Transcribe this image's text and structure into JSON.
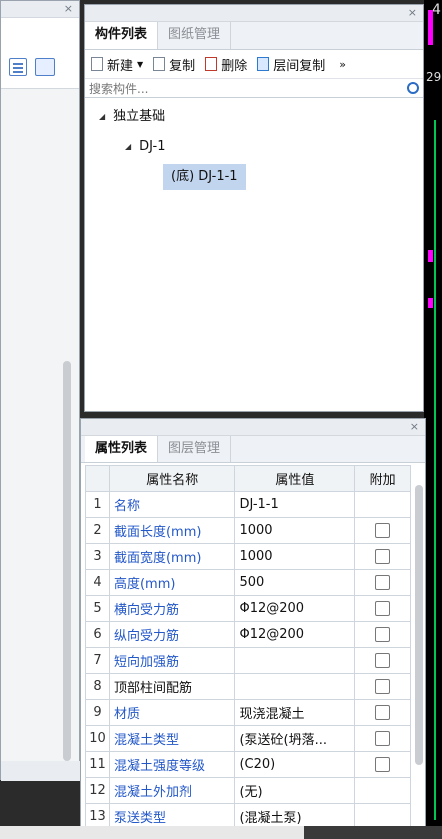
{
  "component_panel": {
    "tabs": [
      {
        "label": "构件列表",
        "active": true
      },
      {
        "label": "图纸管理",
        "active": false
      }
    ],
    "toolbar": {
      "new_label": "新建",
      "copy_label": "复制",
      "delete_label": "删除",
      "floor_copy_label": "层间复制",
      "more_icon": "»"
    },
    "search_placeholder": "搜索构件...",
    "tree": {
      "root": "独立基础",
      "child": "DJ-1",
      "leaf": "(底) DJ-1-1"
    },
    "close_glyph": "×"
  },
  "property_panel": {
    "tabs": [
      {
        "label": "属性列表",
        "active": true
      },
      {
        "label": "图层管理",
        "active": false
      }
    ],
    "close_glyph": "×",
    "headers": {
      "name": "属性名称",
      "value": "属性值",
      "extra": "附加"
    },
    "rows": [
      {
        "n": "1",
        "name": "名称",
        "value": "DJ-1-1",
        "blue": true,
        "check": false
      },
      {
        "n": "2",
        "name": "截面长度(mm)",
        "value": "1000",
        "blue": true,
        "check": true
      },
      {
        "n": "3",
        "name": "截面宽度(mm)",
        "value": "1000",
        "blue": true,
        "check": true
      },
      {
        "n": "4",
        "name": "高度(mm)",
        "value": "500",
        "blue": true,
        "check": true
      },
      {
        "n": "5",
        "name": "横向受力筋",
        "value": "Φ12@200",
        "blue": true,
        "check": true
      },
      {
        "n": "6",
        "name": "纵向受力筋",
        "value": "Φ12@200",
        "blue": true,
        "check": true
      },
      {
        "n": "7",
        "name": "短向加强筋",
        "value": "",
        "blue": true,
        "check": true
      },
      {
        "n": "8",
        "name": "顶部柱间配筋",
        "value": "",
        "blue": false,
        "check": true
      },
      {
        "n": "9",
        "name": "材质",
        "value": "现浇混凝土",
        "blue": true,
        "check": true
      },
      {
        "n": "10",
        "name": "混凝土类型",
        "value": "(泵送砼(坍落...",
        "blue": true,
        "check": true
      },
      {
        "n": "11",
        "name": "混凝土强度等级",
        "value": "(C20)",
        "blue": true,
        "check": true
      },
      {
        "n": "12",
        "name": "混凝土外加剂",
        "value": "(无)",
        "blue": true,
        "check": false
      },
      {
        "n": "13",
        "name": "泵送类型",
        "value": "(混凝土泵)",
        "blue": true,
        "check": false
      }
    ]
  },
  "left_panel": {
    "close_glyph": "×"
  },
  "cad": {
    "label": "29",
    "label2": "4",
    "accent": "#ff00ff",
    "line": "#00c853"
  }
}
